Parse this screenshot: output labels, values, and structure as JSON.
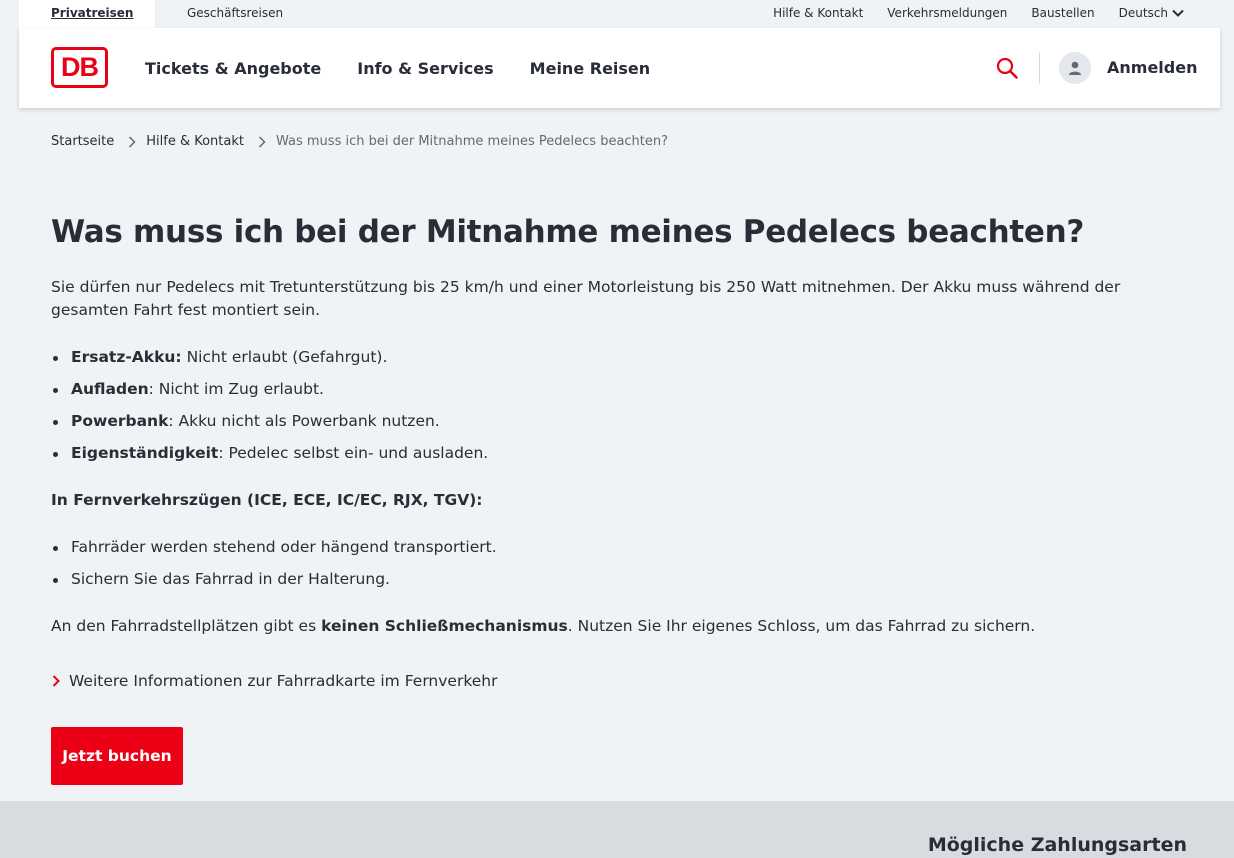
{
  "topbar": {
    "tab_private": "Privatreisen",
    "tab_business": "Geschäftsreisen",
    "help": "Hilfe & Kontakt",
    "traffic": "Verkehrsmeldungen",
    "construction": "Baustellen",
    "language": "Deutsch"
  },
  "header": {
    "logo": "DB",
    "nav": [
      "Tickets & Angebote",
      "Info & Services",
      "Meine Reisen"
    ],
    "login": "Anmelden"
  },
  "breadcrumb": {
    "home": "Startseite",
    "section": "Hilfe & Kontakt",
    "current": "Was muss ich bei der Mitnahme meines Pedelecs beachten?"
  },
  "main": {
    "title": "Was muss ich bei der Mitnahme meines Pedelecs beachten?",
    "intro": "Sie dürfen nur Pedelecs mit Tretunterstützung bis 25 km/h und einer Motorleistung bis 250 Watt mitnehmen. Der Akku muss während der gesamten Fahrt fest montiert sein.",
    "rules": [
      {
        "term": "Ersatz-Akku:",
        "text": " Nicht erlaubt (Gefahrgut)."
      },
      {
        "term": "Aufladen",
        "text": ": Nicht im Zug erlaubt."
      },
      {
        "term": "Powerbank",
        "text": ": Akku nicht als Powerbank nutzen."
      },
      {
        "term": "Eigenständigkeit",
        "text": ": Pedelec selbst ein- und ausladen."
      }
    ],
    "subheading": "In Fernverkehrszügen (ICE, ECE, IC/EC, RJX, TGV):",
    "long_distance": [
      "Fahrräder werden stehend oder hängend transportiert.",
      "Sichern Sie das Fahrrad in der Halterung."
    ],
    "lock_before": "An den Fahrradstellplätzen gibt es ",
    "lock_bold": "keinen Schließmechanismus",
    "lock_after": ". Nutzen Sie Ihr eigenes Schloss, um das Fahrrad zu sichern.",
    "more_link": "Weitere Informationen zur Fahrradkarte im Fernverkehr",
    "book_button": "Jetzt buchen"
  },
  "footer": {
    "payment_heading": "Mögliche Zahlungsarten"
  },
  "colors": {
    "brand_red": "#ec0016",
    "text": "#282d37",
    "page_bg": "#f0f3f5"
  }
}
